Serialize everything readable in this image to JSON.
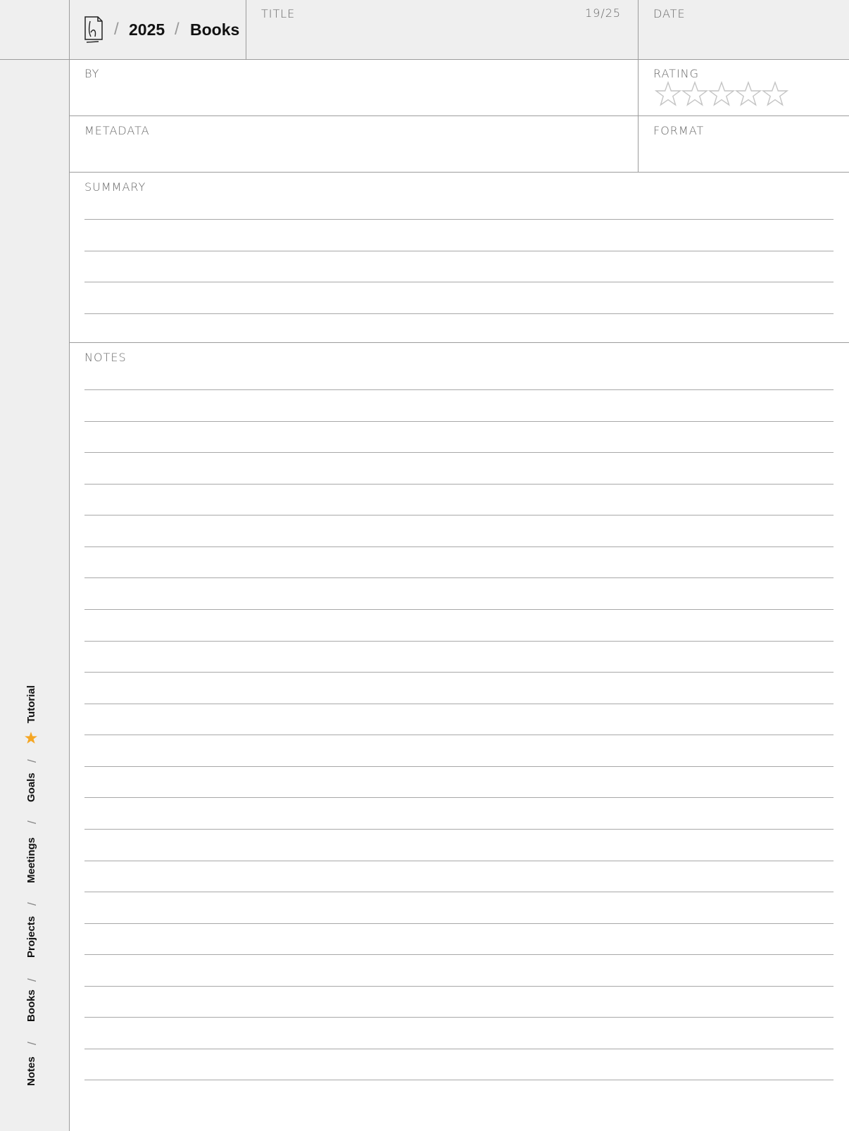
{
  "header": {
    "breadcrumb": {
      "year": "2025",
      "section": "Books",
      "separator": "/"
    },
    "title_label": "TITLE",
    "page_counter": "19/25",
    "date_label": "DATE"
  },
  "fields": {
    "by_label": "BY",
    "rating_label": "RATING",
    "rating": {
      "value": 0,
      "max": 5
    },
    "metadata_label": "METADATA",
    "format_label": "FORMAT",
    "summary_label": "SUMMARY",
    "notes_label": "NOTES"
  },
  "sidebar": {
    "tabs": [
      {
        "label": "Notes"
      },
      {
        "label": "Books"
      },
      {
        "label": "Projects"
      },
      {
        "label": "Meetings"
      },
      {
        "label": "Goals"
      },
      {
        "label": "Tutorial",
        "icon": "star-icon",
        "icon_color": "#f5a623"
      }
    ],
    "separator": "/"
  },
  "colors": {
    "header_bg": "#efefef",
    "border": "#9c9c9c",
    "star_outline": "#c4c4c4",
    "accent": "#f5a623"
  }
}
